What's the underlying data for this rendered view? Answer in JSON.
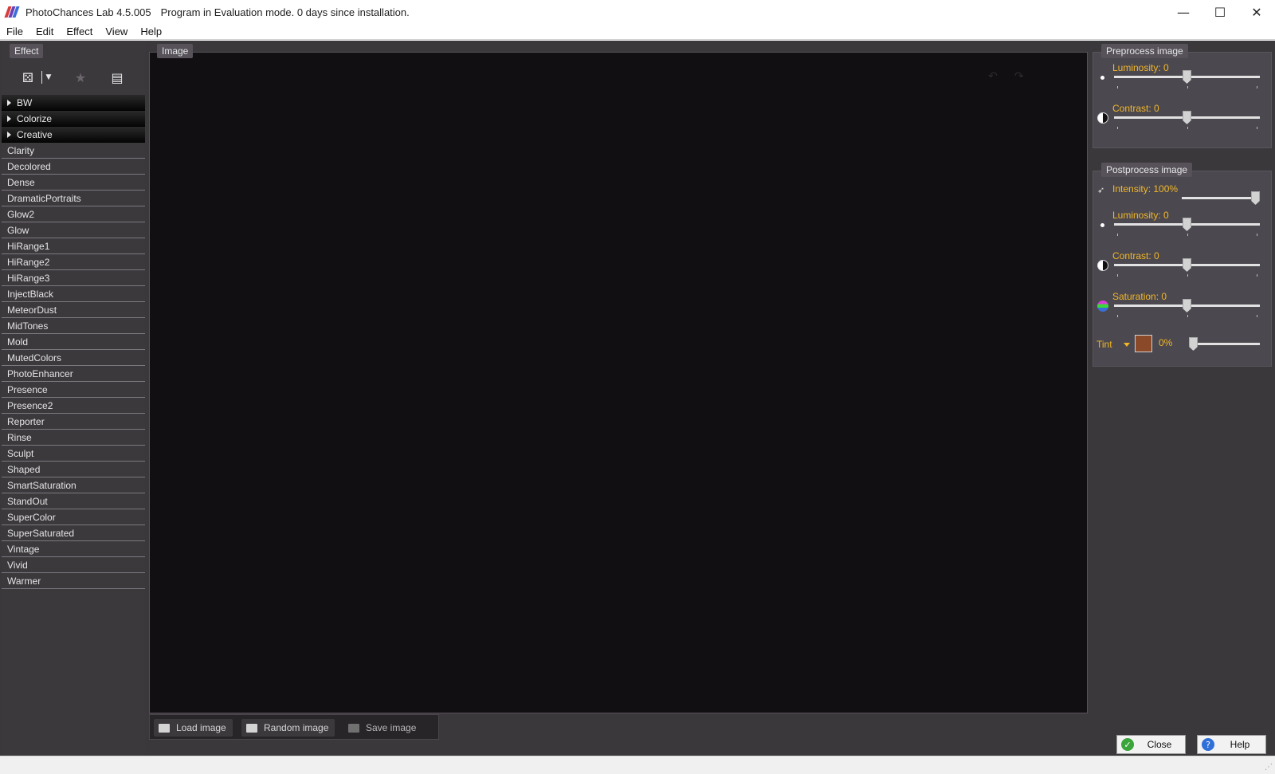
{
  "window": {
    "app_title": "PhotoChances Lab 4.5.005",
    "status_message": "Program in Evaluation mode. 0 days since installation.",
    "minimize_glyph": "—",
    "maximize_glyph": "☐",
    "close_glyph": "✕"
  },
  "menu": [
    "File",
    "Edit",
    "Effect",
    "View",
    "Help"
  ],
  "effect_panel": {
    "title": "Effect",
    "groups": [
      "BW",
      "Colorize",
      "Creative"
    ],
    "items": [
      "Clarity",
      "Decolored",
      "Dense",
      "DramaticPortraits",
      "Glow2",
      "Glow",
      "HiRange1",
      "HiRange2",
      "HiRange3",
      "InjectBlack",
      "MeteorDust",
      "MidTones",
      "Mold",
      "MutedColors",
      "PhotoEnhancer",
      "Presence",
      "Presence2",
      "Reporter",
      "Rinse",
      "Sculpt",
      "Shaped",
      "SmartSaturation",
      "StandOut",
      "SuperColor",
      "SuperSaturated",
      "Vintage",
      "Vivid",
      "Warmer"
    ]
  },
  "image_panel": {
    "title": "Image",
    "load_label": "Load image",
    "random_label": "Random image",
    "save_label": "Save image"
  },
  "preprocess": {
    "title": "Preprocess image",
    "luminosity_label": "Luminosity: 0",
    "luminosity_value": 0.5,
    "contrast_label": "Contrast: 0",
    "contrast_value": 0.5
  },
  "postprocess": {
    "title": "Postprocess image",
    "intensity_label": "Intensity: 100%",
    "intensity_value": 1.0,
    "luminosity_label": "Luminosity: 0",
    "luminosity_value": 0.5,
    "contrast_label": "Contrast: 0",
    "contrast_value": 0.5,
    "saturation_label": "Saturation: 0",
    "saturation_value": 0.5,
    "tint_label": "Tint",
    "tint_percent": "0%",
    "tint_value": 0.0,
    "tint_color": "#8a4a2a"
  },
  "buttons": {
    "close_label": "Close",
    "help_label": "Help"
  },
  "colors": {
    "accent_label": "#f0b72a",
    "image_bg": "#120f13"
  }
}
